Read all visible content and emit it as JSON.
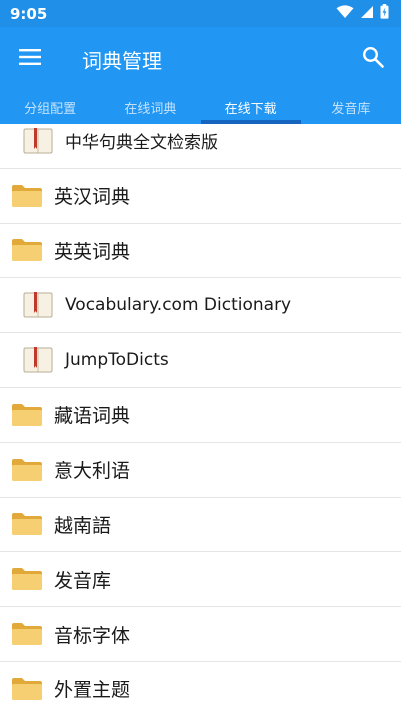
{
  "status_bar": {
    "time": "9:05"
  },
  "app_bar": {
    "title": "词典管理"
  },
  "tabs": [
    {
      "label": "分组配置",
      "active": false
    },
    {
      "label": "在线词典",
      "active": false
    },
    {
      "label": "在线下载",
      "active": true
    },
    {
      "label": "发音库",
      "active": false
    }
  ],
  "list": [
    {
      "type": "dict",
      "label": "中华句典全文检索版"
    },
    {
      "type": "folder",
      "label": "英汉词典"
    },
    {
      "type": "folder",
      "label": "英英词典"
    },
    {
      "type": "dict",
      "label": "Vocabulary.com Dictionary"
    },
    {
      "type": "dict",
      "label": "JumpToDicts"
    },
    {
      "type": "folder",
      "label": "藏语词典"
    },
    {
      "type": "folder",
      "label": "意大利语"
    },
    {
      "type": "folder",
      "label": "越南語"
    },
    {
      "type": "folder",
      "label": "发音库"
    },
    {
      "type": "folder",
      "label": "音标字体"
    },
    {
      "type": "folder",
      "label": "外置主题"
    }
  ],
  "colors": {
    "primary": "#2196f3",
    "status_bar": "#1f8fe8",
    "tab_indicator": "#1565c0",
    "folder": "#f2c766"
  },
  "icons": {
    "menu": "hamburger-menu-icon",
    "search": "search-icon",
    "folder": "folder-icon",
    "dict": "book-icon"
  }
}
